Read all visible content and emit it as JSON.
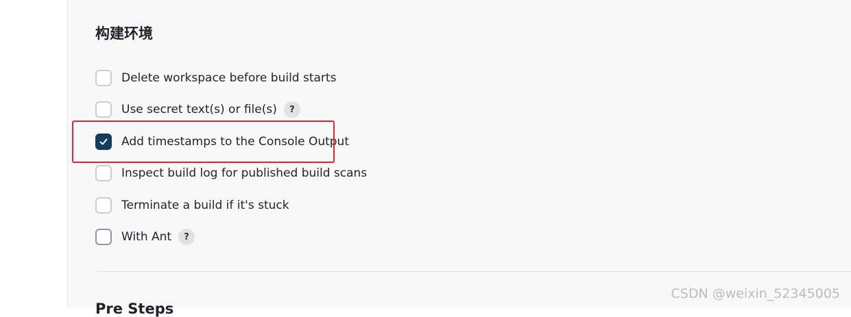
{
  "section": {
    "title": "构建环境"
  },
  "options": [
    {
      "label": "Delete workspace before build starts",
      "checked": false,
      "help": false
    },
    {
      "label": "Use secret text(s) or file(s)",
      "checked": false,
      "help": true
    },
    {
      "label": "Add timestamps to the Console Output",
      "checked": true,
      "help": false
    },
    {
      "label": "Inspect build log for published build scans",
      "checked": false,
      "help": false
    },
    {
      "label": "Terminate a build if it's stuck",
      "checked": false,
      "help": false
    },
    {
      "label": "With Ant",
      "checked": false,
      "help": true
    }
  ],
  "help_icon_glyph": "?",
  "next_section": {
    "title": "Pre Steps"
  },
  "watermark": "CSDN @weixin_52345005",
  "colors": {
    "checked_fill": "#123d5c",
    "highlight_border": "#e5242c"
  }
}
